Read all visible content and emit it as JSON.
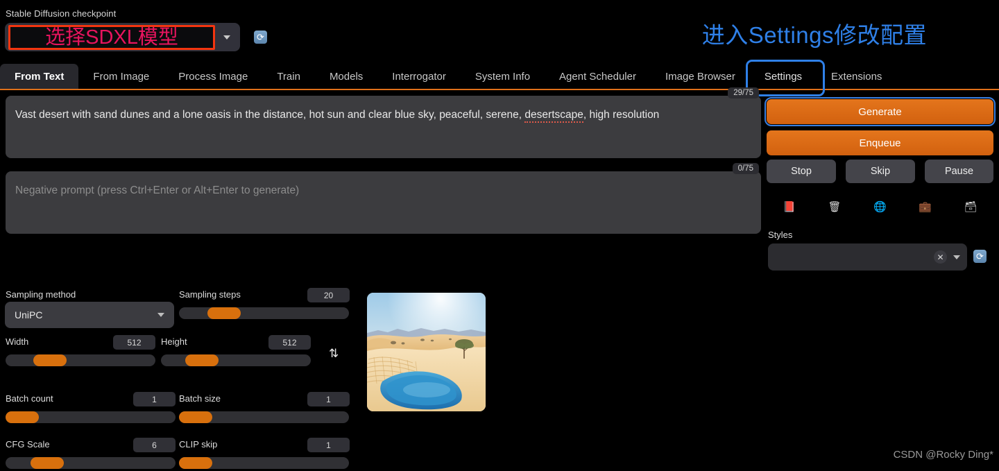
{
  "checkpoint": {
    "label": "Stable Diffusion checkpoint",
    "value": "选择SDXL模型",
    "refresh_icon": "refresh-icon",
    "highlight_color": "#f4350f",
    "value_color": "#e8145e"
  },
  "annotation": {
    "text": "进入Settings修改配置",
    "color": "#2f80e8"
  },
  "tabs": [
    {
      "label": "From Text",
      "active": true,
      "marked": false
    },
    {
      "label": "From Image",
      "active": false,
      "marked": false
    },
    {
      "label": "Process Image",
      "active": false,
      "marked": false
    },
    {
      "label": "Train",
      "active": false,
      "marked": false
    },
    {
      "label": "Models",
      "active": false,
      "marked": false
    },
    {
      "label": "Interrogator",
      "active": false,
      "marked": false
    },
    {
      "label": "System Info",
      "active": false,
      "marked": false
    },
    {
      "label": "Agent Scheduler",
      "active": false,
      "marked": false
    },
    {
      "label": "Image Browser",
      "active": false,
      "marked": false
    },
    {
      "label": "Settings",
      "active": false,
      "marked": true
    },
    {
      "label": "Extensions",
      "active": false,
      "marked": false
    }
  ],
  "prompt": {
    "positive_text_a": "Vast desert with sand dunes and a lone oasis in the distance, hot sun and clear blue sky, peaceful, serene, ",
    "positive_misspelled": "desertscape",
    "positive_text_b": ", high resolution",
    "positive_counter": "29/75",
    "negative_placeholder": "Negative prompt (press Ctrl+Enter or Alt+Enter to generate)",
    "negative_value": "",
    "negative_counter": "0/75"
  },
  "actions": {
    "generate": "Generate",
    "enqueue": "Enqueue",
    "stop": "Stop",
    "skip": "Skip",
    "pause": "Pause",
    "accent_color": "#d2610f"
  },
  "prompt_icons": [
    {
      "name": "read-generation-parameters-icon",
      "glyph": "📕"
    },
    {
      "name": "clear-prompt-icon",
      "glyph": "🗑"
    },
    {
      "name": "network-icon",
      "glyph": "🌐"
    },
    {
      "name": "extra-networks-icon",
      "glyph": "💼"
    },
    {
      "name": "apply-style-icon",
      "glyph": "🗃"
    }
  ],
  "styles": {
    "label": "Styles",
    "value": "",
    "clear_icon": "✕",
    "refresh_icon": "refresh-icon"
  },
  "params": {
    "sampling_method": {
      "label": "Sampling method",
      "value": "UniPC"
    },
    "sampling_steps": {
      "label": "Sampling steps",
      "value": "20",
      "fill_pct": 21
    },
    "width": {
      "label": "Width",
      "value": "512",
      "fill_pct": 22
    },
    "height": {
      "label": "Height",
      "value": "512",
      "fill_pct": 22
    },
    "batch_count": {
      "label": "Batch count",
      "value": "1",
      "fill_pct": 0
    },
    "batch_size": {
      "label": "Batch size",
      "value": "1",
      "fill_pct": 0
    },
    "cfg_scale": {
      "label": "CFG Scale",
      "value": "6",
      "fill_pct": 14
    },
    "clip_skip": {
      "label": "CLIP skip",
      "value": "1",
      "fill_pct": 0
    },
    "swap_icon": "⇅"
  },
  "preview": {
    "alt": "Generated desert landscape with dunes, an oasis lake and a lone tree"
  },
  "watermark": "CSDN @Rocky Ding*"
}
